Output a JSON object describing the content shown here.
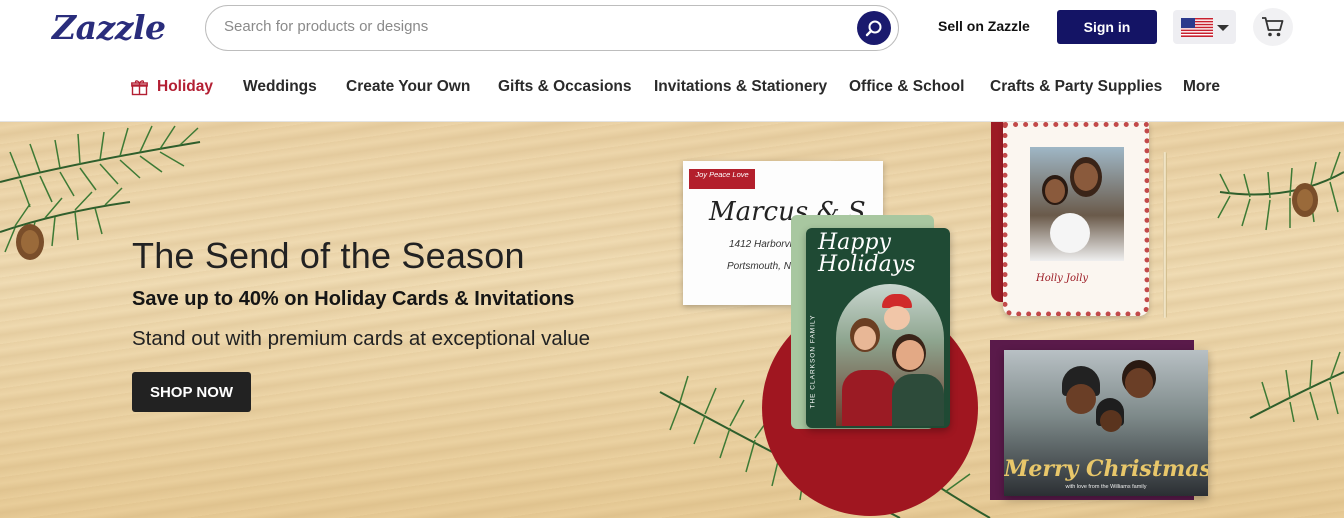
{
  "header": {
    "logo": "Zazzle",
    "search_placeholder": "Search for products or designs",
    "sell_label": "Sell on Zazzle",
    "signin_label": "Sign in",
    "country": "US"
  },
  "nav": {
    "items": [
      {
        "label": "Holiday"
      },
      {
        "label": "Weddings"
      },
      {
        "label": "Create Your Own"
      },
      {
        "label": "Gifts & Occasions"
      },
      {
        "label": "Invitations & Stationery"
      },
      {
        "label": "Office & School"
      },
      {
        "label": "Crafts & Party Supplies"
      },
      {
        "label": "More"
      }
    ]
  },
  "hero": {
    "title": "The Send of the Season",
    "subtitle": "Save up to 40% on Holiday Cards & Invitations",
    "description": "Stand out with premium cards at exceptional value",
    "cta_label": "SHOP NOW",
    "card_texts": {
      "envelope_label": "Joy Peace Love",
      "envelope_name": "Marcus & S",
      "envelope_addr1": "1412 Harborview",
      "envelope_addr2": "Portsmouth, NY",
      "card1_greeting": "Happy Holidays",
      "card1_family": "THE CLARKSON FAMILY",
      "card2_greeting": "Holly Jolly",
      "card3_greeting": "Merry Christmas",
      "card3_family": "with love from the Williams family"
    }
  },
  "colors": {
    "brand_navy": "#141465",
    "holiday_red": "#b31f33",
    "cta_dark": "#222222"
  }
}
